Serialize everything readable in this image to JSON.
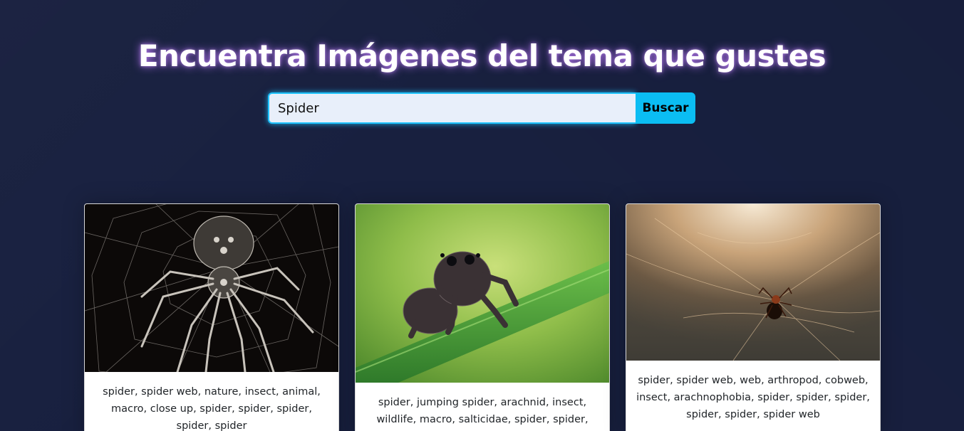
{
  "header": {
    "title": "Encuentra Imágenes del tema que gustes"
  },
  "search": {
    "value": "Spider",
    "placeholder": "",
    "button_label": "Buscar"
  },
  "results": [
    {
      "image_icon": "spider-on-web-photo",
      "tags": "spider, spider web, nature, insect, animal, macro, close up, spider, spider, spider, spider, spider"
    },
    {
      "image_icon": "jumping-spider-on-grass-photo",
      "tags": "spider, jumping spider, arachnid, insect, wildlife, macro, salticidae, spider, spider,"
    },
    {
      "image_icon": "spider-in-cobweb-photo",
      "tags": "spider, spider web, web, arthropod, cobweb, insect, arachnophobia, spider, spider, spider, spider, spider, spider web"
    }
  ],
  "colors": {
    "background": "#18203f",
    "accent": "#0bbdf3",
    "title_glow": "#be78ff",
    "input_bg": "#e8effa"
  }
}
